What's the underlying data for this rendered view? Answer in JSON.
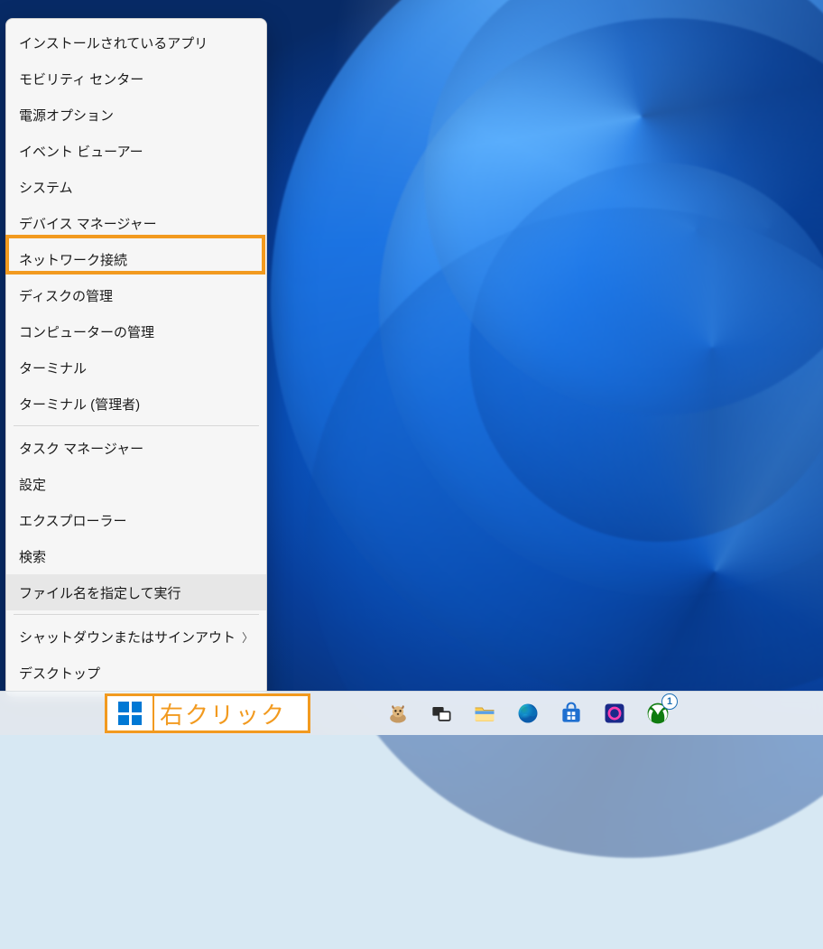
{
  "winx_menu": {
    "items": [
      {
        "label": "インストールされているアプリ",
        "submenu": false
      },
      {
        "label": "モビリティ センター",
        "submenu": false
      },
      {
        "label": "電源オプション",
        "submenu": false
      },
      {
        "label": "イベント ビューアー",
        "submenu": false
      },
      {
        "label": "システム",
        "submenu": false
      },
      {
        "label": "デバイス マネージャー",
        "submenu": false
      },
      {
        "label": "ネットワーク接続",
        "submenu": false,
        "highlighted": true
      },
      {
        "label": "ディスクの管理",
        "submenu": false
      },
      {
        "label": "コンピューターの管理",
        "submenu": false
      },
      {
        "label": "ターミナル",
        "submenu": false
      },
      {
        "label": "ターミナル (管理者)",
        "submenu": false
      },
      {
        "label": "タスク マネージャー",
        "submenu": false
      },
      {
        "label": "設定",
        "submenu": false
      },
      {
        "label": "エクスプローラー",
        "submenu": false
      },
      {
        "label": "検索",
        "submenu": false
      },
      {
        "label": "ファイル名を指定して実行",
        "submenu": false,
        "hovered": true
      },
      {
        "label": "シャットダウンまたはサインアウト",
        "submenu": true
      },
      {
        "label": "デスクトップ",
        "submenu": false
      }
    ],
    "separators_after": [
      10,
      15
    ]
  },
  "annotation": {
    "start_label": "右クリック"
  },
  "taskbar": {
    "icons": [
      {
        "name": "start",
        "title": "スタート"
      },
      {
        "name": "search-companion",
        "title": "検索"
      },
      {
        "name": "task-view",
        "title": "タスク ビュー"
      },
      {
        "name": "file-explorer",
        "title": "エクスプローラー"
      },
      {
        "name": "edge",
        "title": "Microsoft Edge"
      },
      {
        "name": "microsoft-store",
        "title": "Microsoft Store"
      },
      {
        "name": "app-generic",
        "title": "アプリ"
      },
      {
        "name": "xbox",
        "title": "Xbox"
      }
    ],
    "xbox_badge": "1"
  },
  "colors": {
    "accent": "#0078d4",
    "highlight": "#f29a1f"
  }
}
